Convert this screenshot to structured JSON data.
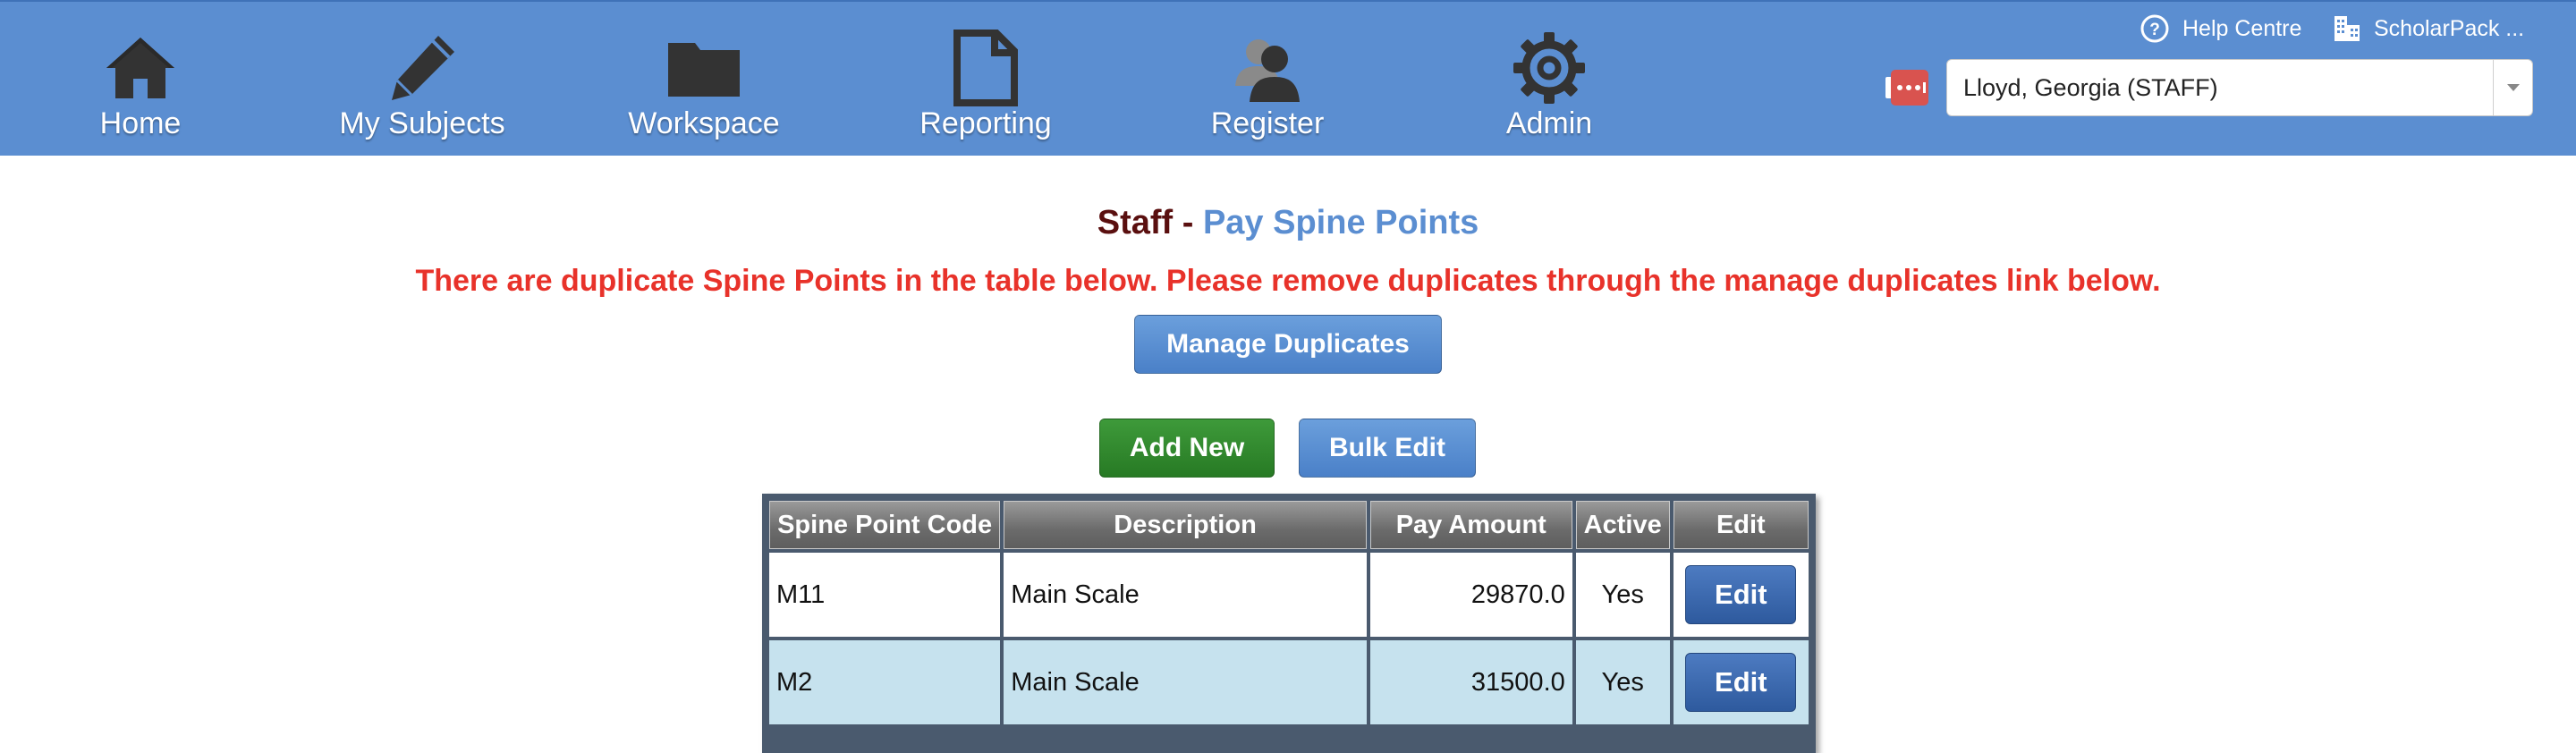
{
  "nav": {
    "items": [
      {
        "label": "Home",
        "icon": "home-icon"
      },
      {
        "label": "My Subjects",
        "icon": "pencil-icon"
      },
      {
        "label": "Workspace",
        "icon": "folder-icon"
      },
      {
        "label": "Reporting",
        "icon": "document-icon"
      },
      {
        "label": "Register",
        "icon": "users-icon"
      },
      {
        "label": "Admin",
        "icon": "gear-icon"
      }
    ],
    "help_label": "Help Centre",
    "school_label": "ScholarPack ...",
    "user_select_value": "Lloyd, Georgia (STAFF)"
  },
  "page": {
    "title_part1": "Staff",
    "title_separator": "-",
    "title_part2": "Pay Spine Points",
    "warning": "There are duplicate Spine Points in the table below. Please remove duplicates through the manage duplicates link below.",
    "manage_duplicates_label": "Manage Duplicates",
    "add_new_label": "Add New",
    "bulk_edit_label": "Bulk Edit"
  },
  "table": {
    "headers": [
      "Spine Point Code",
      "Description",
      "Pay Amount",
      "Active",
      "Edit"
    ],
    "rows": [
      {
        "code": "M11",
        "description": "Main Scale",
        "pay": "29870.0",
        "active": "Yes",
        "edit": "Edit"
      },
      {
        "code": "M2",
        "description": "Main Scale",
        "pay": "31500.0",
        "active": "Yes",
        "edit": "Edit"
      }
    ]
  },
  "colors": {
    "nav_bar": "#5b8ed1",
    "title_dark": "#5a0f0f",
    "title_accent": "#5b8ed1",
    "warning": "#e8322a",
    "add_new": "#2f8a2c",
    "row_alt": "#c6e2ee"
  }
}
